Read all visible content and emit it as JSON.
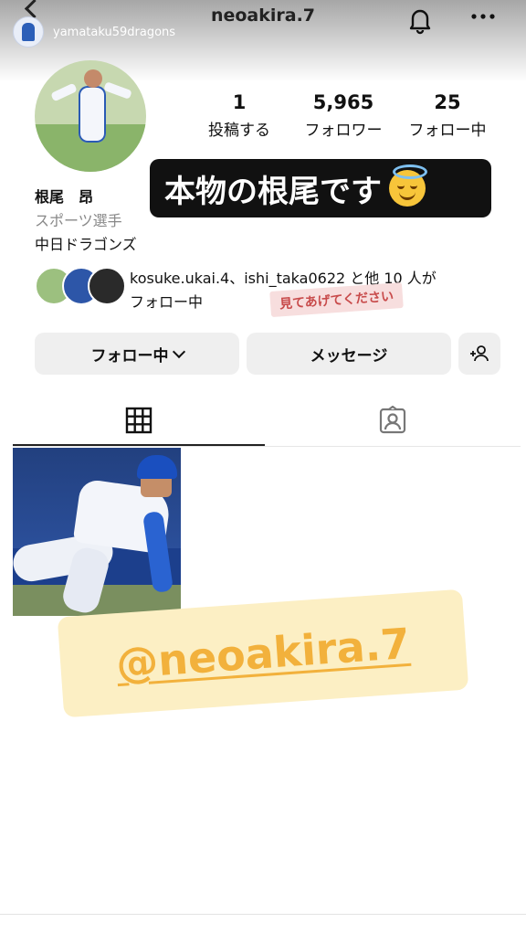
{
  "story": {
    "username": "yamataku59dragons"
  },
  "header": {
    "username": "neoakira.7"
  },
  "stats": [
    {
      "value": "1",
      "label": "投稿する"
    },
    {
      "value": "5,965",
      "label": "フォロワー"
    },
    {
      "value": "25",
      "label": "フォロー中"
    }
  ],
  "profile": {
    "name": "根尾　昂",
    "category": "スポーツ選手",
    "bio": "中日ドラゴンズ"
  },
  "banner": {
    "text": "本物の根尾です"
  },
  "mutuals": {
    "line1": "kosuke.ukai.4、ishi_taka0622 と他 10 人が",
    "line2": "フォロー中"
  },
  "sticker_small": "見てあげてください",
  "buttons": {
    "following": "フォロー中",
    "message": "メッセージ"
  },
  "big_sticker": "@neoakira.7",
  "colors": {
    "sticker_text": "#f2b13c",
    "sticker_bg": "#fcefc4",
    "banner_bg": "#111111"
  }
}
